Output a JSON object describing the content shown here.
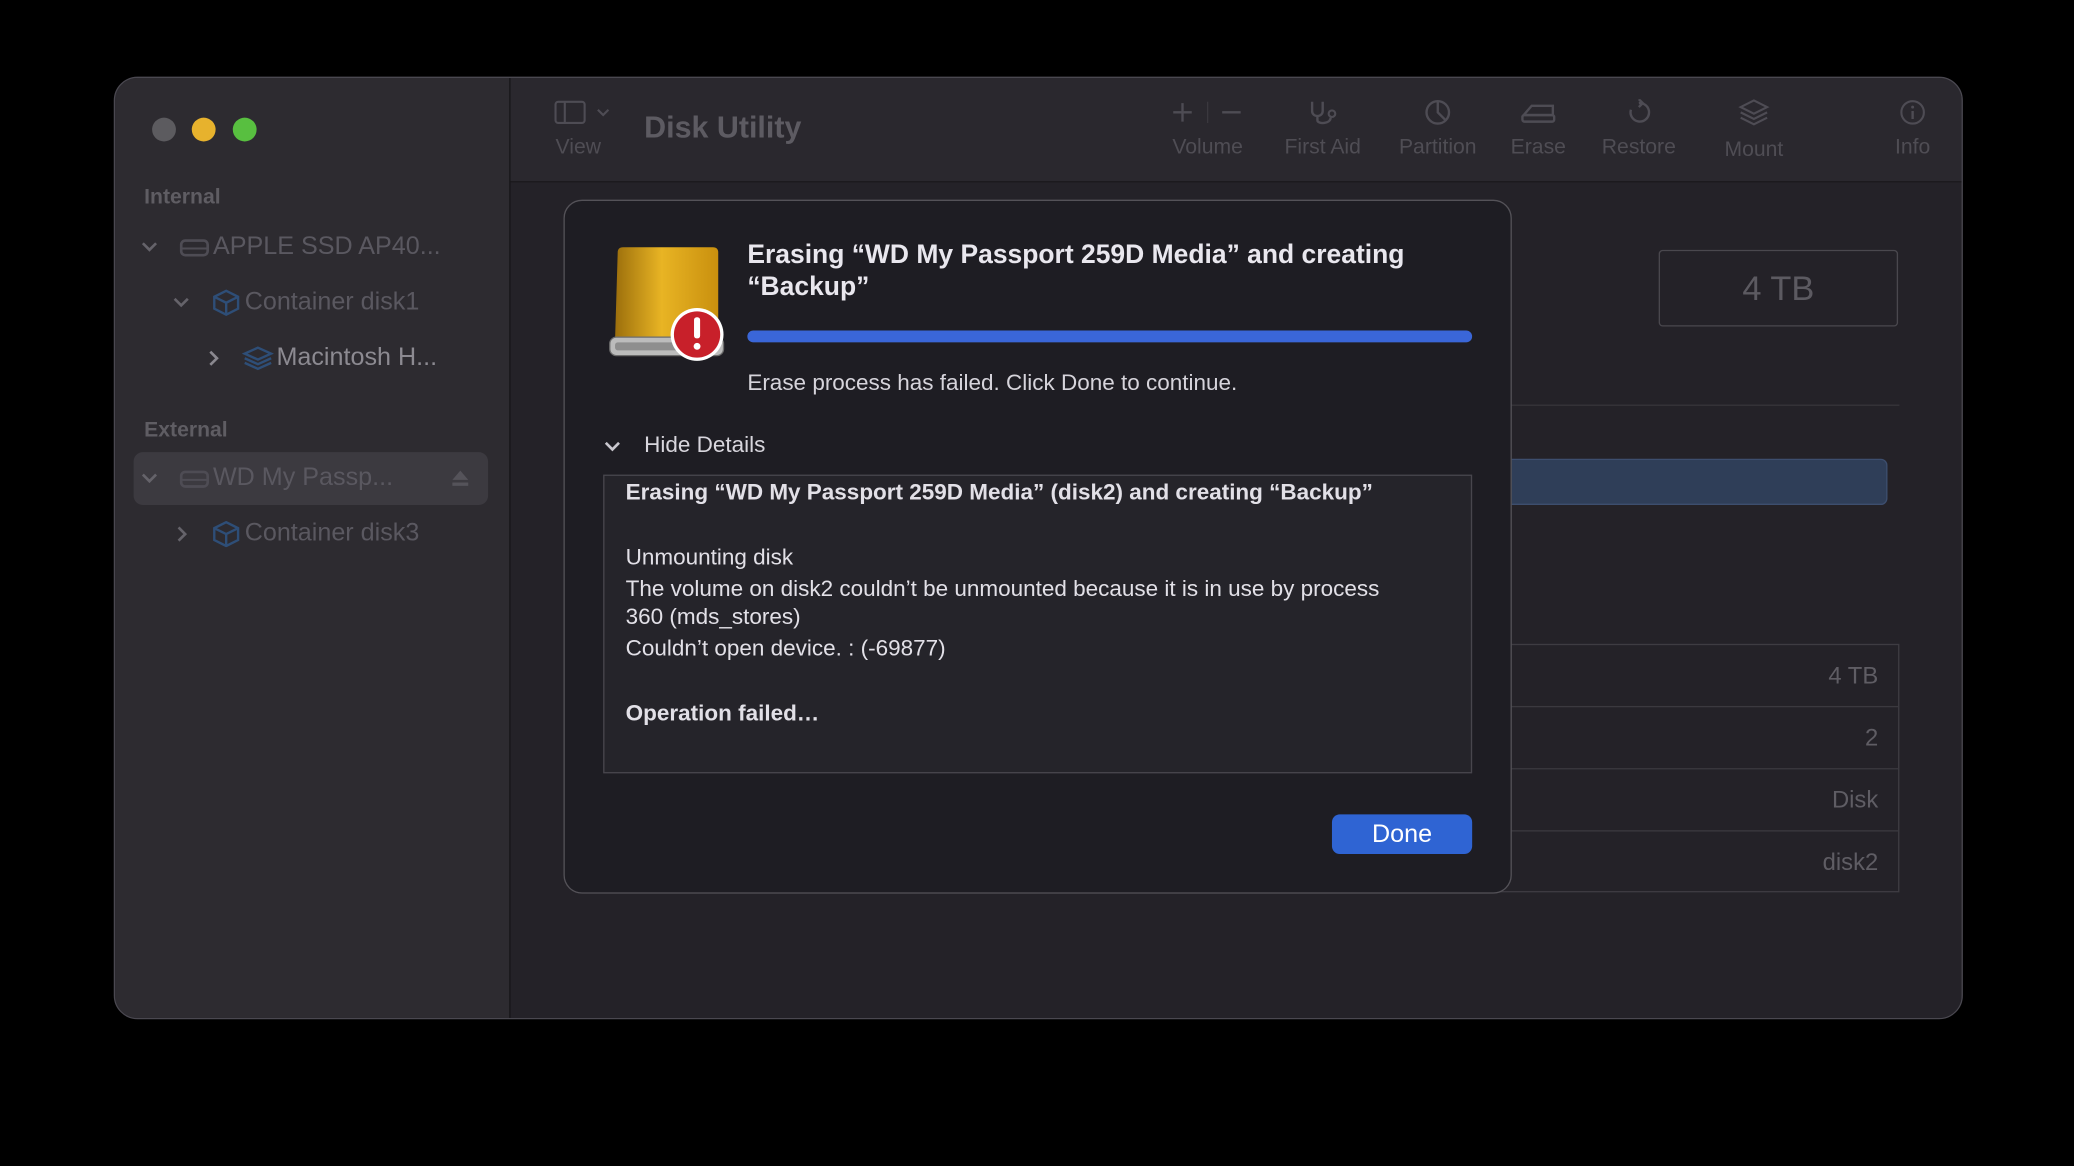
{
  "app": {
    "title": "Disk Utility"
  },
  "toolbar": {
    "view_label": "View",
    "volume_label": "Volume",
    "first_aid_label": "First Aid",
    "partition_label": "Partition",
    "erase_label": "Erase",
    "restore_label": "Restore",
    "mount_label": "Mount",
    "info_label": "Info"
  },
  "sidebar": {
    "internal_header": "Internal",
    "external_header": "External",
    "internal_items": [
      {
        "label": "APPLE SSD AP40..."
      },
      {
        "label": "Container disk1"
      },
      {
        "label": "Macintosh H..."
      }
    ],
    "external_items": [
      {
        "label": "WD My Passp..."
      },
      {
        "label": "Container disk3"
      }
    ]
  },
  "main": {
    "capacity": "4 TB",
    "info_rows": [
      {
        "value": "4 TB"
      },
      {
        "value": "2"
      },
      {
        "value": "Disk"
      },
      {
        "value": "disk2"
      }
    ]
  },
  "dialog": {
    "title": "Erasing “WD My Passport 259D Media” and creating “Backup”",
    "progress": 1.0,
    "status": "Erase process has failed. Click Done to continue.",
    "details_toggle": "Hide Details",
    "log": {
      "line1": "Erasing “WD My Passport 259D Media” (disk2) and creating “Backup”",
      "line2": "Unmounting disk",
      "line3": "The volume on disk2 couldn’t be unmounted because it is in use by process",
      "line4": "360 (mds_stores)",
      "line5": "Couldn’t open device. : (-69877)",
      "line6": "Operation failed…"
    },
    "done_label": "Done"
  },
  "colors": {
    "accent": "#2f64d3",
    "progress": "#3a66d8",
    "warning": "#c8202a",
    "drive": "#e2ad1c"
  }
}
